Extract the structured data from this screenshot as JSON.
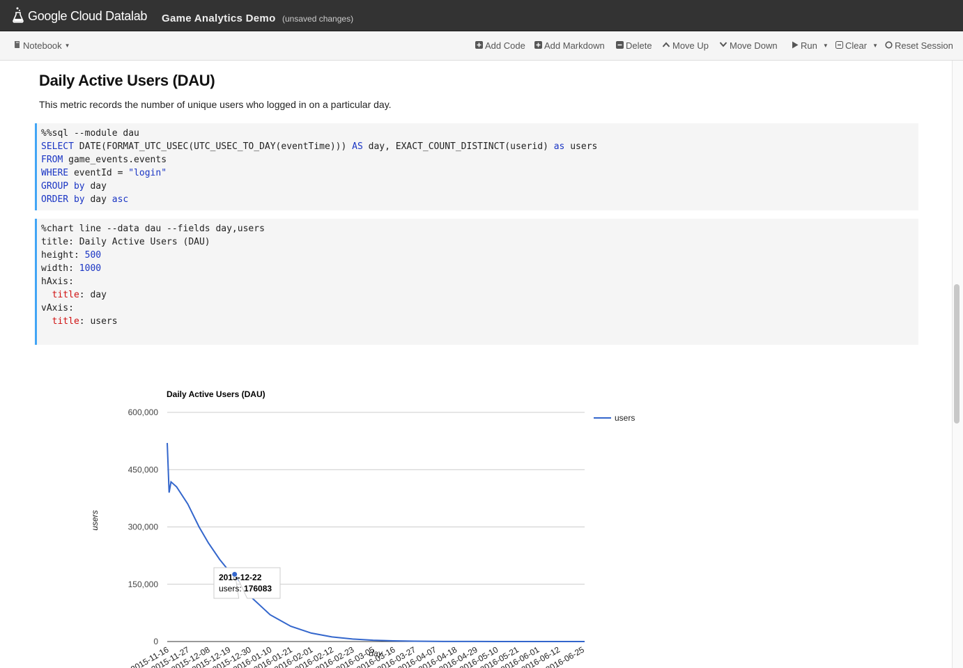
{
  "app": {
    "logo_text": "Google Cloud Datalab",
    "notebook_title": "Game Analytics Demo",
    "status": "(unsaved changes)"
  },
  "toolbar": {
    "notebook_menu": "Notebook",
    "add_code": "Add Code",
    "add_markdown": "Add Markdown",
    "delete": "Delete",
    "move_up": "Move Up",
    "move_down": "Move Down",
    "run": "Run",
    "clear": "Clear",
    "reset_session": "Reset Session"
  },
  "markdown": {
    "heading": "Daily Active Users (DAU)",
    "paragraph": "This metric records the number of unique users who logged in on a particular day."
  },
  "cell1": {
    "line1": "%%sql --module dau",
    "l2_kw1": "SELECT",
    "l2_t1": " DATE(FORMAT_UTC_USEC(UTC_USEC_TO_DAY(eventTime))) ",
    "l2_kw2": "AS",
    "l2_t2": " day, EXACT_COUNT_DISTINCT(userid) ",
    "l2_kw3": "as",
    "l2_t3": " users",
    "l3_kw": "FROM",
    "l3_t": " game_events.events",
    "l4_kw": "WHERE",
    "l4_t": " eventId = ",
    "l4_str": "\"login\"",
    "l5_kw1": "GROUP",
    "l5_kw2": "by",
    "l5_t": " day",
    "l6_kw1": "ORDER",
    "l6_kw2": "by",
    "l6_t": " day ",
    "l6_kw3": "asc"
  },
  "cell2": {
    "line1": "%chart line --data dau --fields day,users",
    "line2": "title: Daily Active Users (DAU)",
    "l3_t": "height: ",
    "l3_num": "500",
    "l4_t": "width: ",
    "l4_num": "1000",
    "line5": "hAxis:",
    "l6_key": "title",
    "l6_t": ": day",
    "line7": "vAxis:",
    "l8_key": "title",
    "l8_t": ": users"
  },
  "chart_data": {
    "type": "line",
    "title": "Daily Active Users (DAU)",
    "xlabel": "day",
    "ylabel": "users",
    "ylim": [
      0,
      600000
    ],
    "yticks": [
      "0",
      "150,000",
      "300,000",
      "450,000",
      "600,000"
    ],
    "xticks": [
      "2015-11-16",
      "2015-11-27",
      "2015-12-08",
      "2015-12-19",
      "2015-12-30",
      "2016-01-10",
      "2016-01-21",
      "2016-02-01",
      "2016-02-12",
      "2016-02-23",
      "2016-03-05",
      "2016-03-16",
      "2016-03-27",
      "2016-04-07",
      "2016-04-18",
      "2016-04-29",
      "2016-05-10",
      "2016-05-21",
      "2016-06-01",
      "2016-06-12",
      "2016-06-25"
    ],
    "legend": "right",
    "grid": true,
    "color": "#3366cc",
    "series": [
      {
        "name": "users",
        "points": [
          [
            "2015-11-16",
            520000
          ],
          [
            "2015-11-17",
            390000
          ],
          [
            "2015-11-18",
            418000
          ],
          [
            "2015-11-21",
            405000
          ],
          [
            "2015-11-27",
            360000
          ],
          [
            "2015-12-03",
            300000
          ],
          [
            "2015-12-08",
            258000
          ],
          [
            "2015-12-14",
            215000
          ],
          [
            "2015-12-19",
            185000
          ],
          [
            "2015-12-22",
            176083
          ],
          [
            "2015-12-30",
            120000
          ],
          [
            "2016-01-10",
            70000
          ],
          [
            "2016-01-21",
            40000
          ],
          [
            "2016-02-01",
            22000
          ],
          [
            "2016-02-12",
            12000
          ],
          [
            "2016-02-23",
            6500
          ],
          [
            "2016-03-05",
            3500
          ],
          [
            "2016-03-16",
            1800
          ],
          [
            "2016-03-27",
            900
          ],
          [
            "2016-04-07",
            450
          ],
          [
            "2016-04-18",
            200
          ],
          [
            "2016-04-29",
            100
          ],
          [
            "2016-05-10",
            50
          ],
          [
            "2016-05-21",
            20
          ],
          [
            "2016-06-01",
            10
          ],
          [
            "2016-06-12",
            5
          ],
          [
            "2016-06-25",
            0
          ],
          [
            "2016-06-26",
            0
          ]
        ]
      }
    ],
    "tooltip": {
      "date": "2015-12-22",
      "label": "users: ",
      "value": "176083"
    }
  }
}
